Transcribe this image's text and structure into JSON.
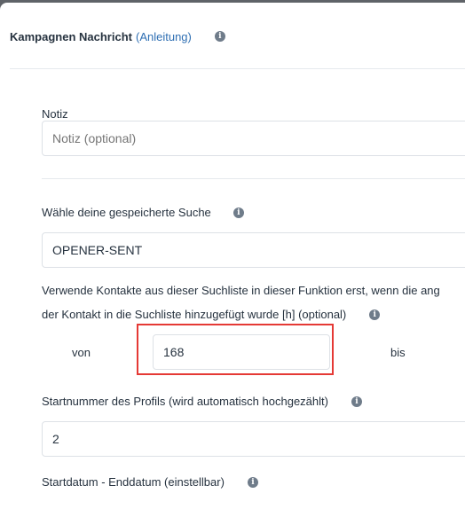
{
  "header": {
    "title": "Kampagnen Nachricht",
    "link": "(Anleitung)",
    "info_icon": "info-icon"
  },
  "note": {
    "label": "Notiz",
    "placeholder": "Notiz (optional)",
    "value": ""
  },
  "saved_search": {
    "label": "Wähle deine gespeicherte Suche",
    "value": "OPENER-SENT"
  },
  "contacts_delay": {
    "text_line1": "Verwende Kontakte aus dieser Suchliste in dieser Funktion erst, wenn die ang",
    "text_line2": "der Kontakt in die Suchliste hinzugefügt wurde [h] (optional)",
    "from_label": "von",
    "from_value": "168",
    "to_label": "bis"
  },
  "start_number": {
    "label": "Startnummer des Profils (wird automatisch hochgezählt)",
    "value": "2"
  },
  "date_range": {
    "label": "Startdatum - Enddatum (einstellbar)"
  },
  "colors": {
    "accent_link": "#2f6fb3",
    "highlight": "#e53935",
    "overlay": "#5f6368"
  }
}
